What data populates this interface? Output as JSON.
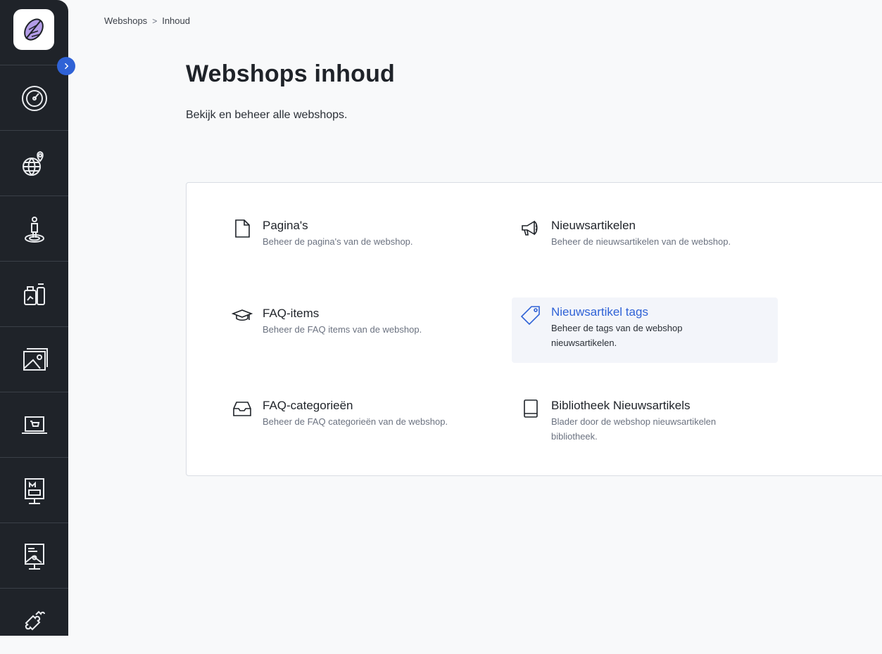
{
  "breadcrumb": {
    "parent": "Webshops",
    "separator": ">",
    "current": "Inhoud"
  },
  "header": {
    "title": "Webshops inhoud",
    "subtitle": "Bekijk en beheer alle webshops."
  },
  "sidebar": {
    "expand_icon": "chevron-right-icon",
    "items": [
      {
        "icon": "dashboard-icon"
      },
      {
        "icon": "globe-location-icon"
      },
      {
        "icon": "person-location-icon"
      },
      {
        "icon": "products-icon"
      },
      {
        "icon": "image-gallery-icon"
      },
      {
        "icon": "laptop-cart-icon"
      },
      {
        "icon": "monitor-media-icon"
      },
      {
        "icon": "presentation-icon"
      },
      {
        "icon": "puzzle-icon"
      }
    ]
  },
  "content_items": [
    {
      "title": "Pagina's",
      "description": "Beheer de pagina's van de webshop.",
      "icon": "page-icon"
    },
    {
      "title": "Nieuwsartikelen",
      "description": "Beheer de nieuwsartikelen van de webshop.",
      "icon": "megaphone-icon"
    },
    {
      "title": "FAQ-items",
      "description": "Beheer de FAQ items van de webshop.",
      "icon": "graduation-cap-icon"
    },
    {
      "title": "Nieuwsartikel tags",
      "description_line1": "Beheer de tags van de webshop",
      "description_line2": "nieuwsartikelen.",
      "icon": "tag-icon",
      "active": true
    },
    {
      "title": "FAQ-categorieën",
      "description": "Beheer de FAQ categorieën van de webshop.",
      "icon": "inbox-icon"
    },
    {
      "title": "Bibliotheek Nieuwsartikels",
      "description_line1": "Blader door de webshop nieuwsartikelen",
      "description_line2": "bibliotheek.",
      "icon": "book-icon"
    }
  ],
  "colors": {
    "sidebar_bg": "#1f2329",
    "accent": "#2f62d6",
    "active_bg": "#f3f5fa"
  }
}
